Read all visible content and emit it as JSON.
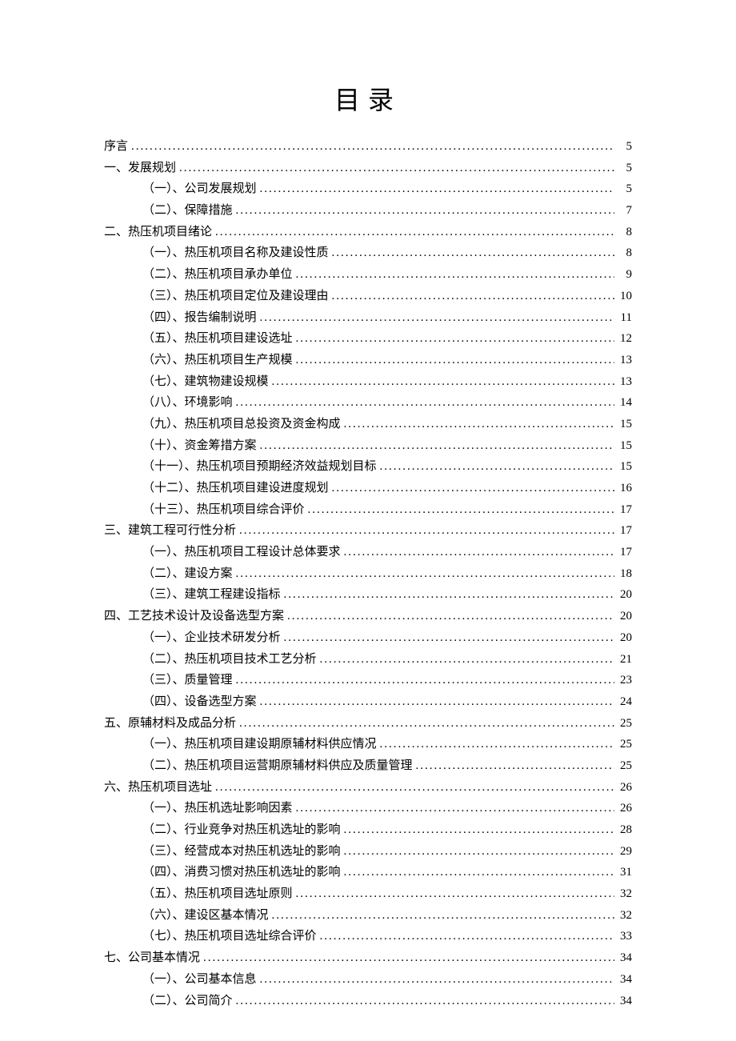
{
  "title": "目录",
  "toc": [
    {
      "level": 1,
      "label": "序言",
      "page": "5"
    },
    {
      "level": 1,
      "label": "一、发展规划",
      "page": "5"
    },
    {
      "level": 2,
      "label": "（一）、公司发展规划",
      "page": "5"
    },
    {
      "level": 2,
      "label": "（二）、保障措施",
      "page": "7"
    },
    {
      "level": 1,
      "label": "二、热压机项目绪论",
      "page": "8"
    },
    {
      "level": 2,
      "label": "（一）、热压机项目名称及建设性质",
      "page": "8"
    },
    {
      "level": 2,
      "label": "（二）、热压机项目承办单位",
      "page": "9"
    },
    {
      "level": 2,
      "label": "（三）、热压机项目定位及建设理由",
      "page": "10"
    },
    {
      "level": 2,
      "label": "（四）、报告编制说明",
      "page": "11"
    },
    {
      "level": 2,
      "label": "（五）、热压机项目建设选址",
      "page": "12"
    },
    {
      "level": 2,
      "label": "（六）、热压机项目生产规模",
      "page": "13"
    },
    {
      "level": 2,
      "label": "（七）、建筑物建设规模",
      "page": "13"
    },
    {
      "level": 2,
      "label": "（八）、环境影响",
      "page": "14"
    },
    {
      "level": 2,
      "label": "（九）、热压机项目总投资及资金构成",
      "page": "15"
    },
    {
      "level": 2,
      "label": "（十）、资金筹措方案",
      "page": "15"
    },
    {
      "level": 2,
      "label": "（十一）、热压机项目预期经济效益规划目标",
      "page": "15"
    },
    {
      "level": 2,
      "label": "（十二）、热压机项目建设进度规划",
      "page": "16"
    },
    {
      "level": 2,
      "label": "（十三）、热压机项目综合评价",
      "page": "17"
    },
    {
      "level": 1,
      "label": "三、建筑工程可行性分析",
      "page": "17"
    },
    {
      "level": 2,
      "label": "（一）、热压机项目工程设计总体要求",
      "page": "17"
    },
    {
      "level": 2,
      "label": "（二）、建设方案",
      "page": "18"
    },
    {
      "level": 2,
      "label": "（三）、建筑工程建设指标",
      "page": "20"
    },
    {
      "level": 1,
      "label": "四、工艺技术设计及设备选型方案",
      "page": "20"
    },
    {
      "level": 2,
      "label": "（一）、企业技术研发分析",
      "page": "20"
    },
    {
      "level": 2,
      "label": "（二）、热压机项目技术工艺分析",
      "page": "21"
    },
    {
      "level": 2,
      "label": "（三）、质量管理",
      "page": "23"
    },
    {
      "level": 2,
      "label": "（四）、设备选型方案",
      "page": "24"
    },
    {
      "level": 1,
      "label": "五、原辅材料及成品分析",
      "page": "25"
    },
    {
      "level": 2,
      "label": "（一）、热压机项目建设期原辅材料供应情况",
      "page": "25"
    },
    {
      "level": 2,
      "label": "（二）、热压机项目运营期原辅材料供应及质量管理",
      "page": "25"
    },
    {
      "level": 1,
      "label": "六、热压机项目选址",
      "page": "26"
    },
    {
      "level": 2,
      "label": "（一）、热压机选址影响因素",
      "page": "26"
    },
    {
      "level": 2,
      "label": "（二）、行业竞争对热压机选址的影响",
      "page": "28"
    },
    {
      "level": 2,
      "label": "（三）、经营成本对热压机选址的影响",
      "page": "29"
    },
    {
      "level": 2,
      "label": "（四）、消费习惯对热压机选址的影响",
      "page": "31"
    },
    {
      "level": 2,
      "label": "（五）、热压机项目选址原则",
      "page": "32"
    },
    {
      "level": 2,
      "label": "（六）、建设区基本情况",
      "page": "32"
    },
    {
      "level": 2,
      "label": "（七）、热压机项目选址综合评价",
      "page": "33"
    },
    {
      "level": 1,
      "label": "七、公司基本情况",
      "page": "34"
    },
    {
      "level": 2,
      "label": "（一）、公司基本信息",
      "page": "34"
    },
    {
      "level": 2,
      "label": "（二）、公司简介",
      "page": "34"
    }
  ]
}
